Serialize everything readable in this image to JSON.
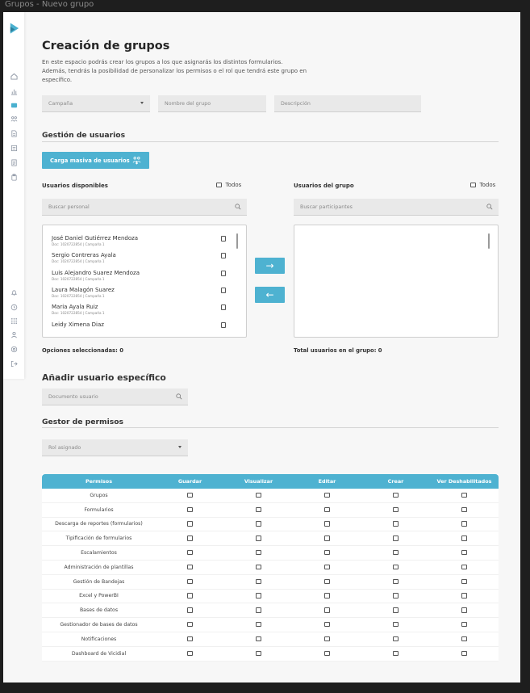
{
  "window": {
    "title": "Grupos - Nuevo grupo"
  },
  "colors": {
    "accent": "#4eb2d1",
    "background": "#f7f7f7"
  },
  "sidebar": {
    "logo": "logo-icon",
    "top_icons": [
      "home-icon",
      "chart-icon",
      "groups-icon",
      "users-icon",
      "forms-icon",
      "reports-icon",
      "document-icon",
      "clipboard-icon"
    ],
    "bottom_icons": [
      "bell-icon",
      "history-icon",
      "grid-icon",
      "profile-icon",
      "settings-icon",
      "logout-icon"
    ]
  },
  "page": {
    "title": "Creación de grupos",
    "intro": "En este espacio podrás crear los grupos a los que asignarás los distintos formularios. Además, tendrás la posibilidad de personalizar los permisos o el rol que tendrá este grupo en específico."
  },
  "form": {
    "campaign_placeholder": "Campaña",
    "group_name_placeholder": "Nombre del grupo",
    "description_placeholder": "Descripción"
  },
  "user_management": {
    "heading": "Gestión de usuarios",
    "mass_upload_label": "Carga masiva de usuarios",
    "available": {
      "title": "Usuarios disponibles",
      "all_label": "Todos",
      "search_placeholder": "Buscar personal",
      "users": [
        {
          "name": "José Daniel Gutiérrez Mendoza",
          "doc": "Doc: 1020722854 | Campaña 1"
        },
        {
          "name": "Sergio Contreras Ayala",
          "doc": "Doc: 1020722854 | Campaña 1"
        },
        {
          "name": "Luis Alejandro Suarez Mendoza",
          "doc": "Doc: 1020722854 | Campaña 1"
        },
        {
          "name": "Laura Malagón Suarez",
          "doc": "Doc: 1020722854 | Campaña 1"
        },
        {
          "name": "Maria Ayala Ruiz",
          "doc": "Doc: 1020722854 | Campaña 1"
        },
        {
          "name": "Leidy Ximena Diaz",
          "doc": ""
        }
      ],
      "selected_label": "Opciones seleccionadas: 0"
    },
    "group": {
      "title": "Usuarios del grupo",
      "all_label": "Todos",
      "search_placeholder": "Buscar participantes",
      "total_label": "Total usuarios en el grupo: 0"
    },
    "move_right": "→",
    "move_left": "←"
  },
  "specific_user": {
    "heading": "Añadir usuario específico",
    "document_placeholder": "Documento usuario"
  },
  "permissions": {
    "heading": "Gestor de permisos",
    "role_placeholder": "Rol asignado",
    "columns": [
      "Permisos",
      "Guardar",
      "Visualizar",
      "Editar",
      "Crear",
      "Ver Deshabilitados"
    ],
    "rows": [
      "Grupos",
      "Formularios",
      "Descarga de reportes (formularios)",
      "Tipificación de formularios",
      "Escalamientos",
      "Administración de plantillas",
      "Gestión de Bandejas",
      "Excel y PowerBI",
      "Bases de datos",
      "Gestionador de bases de datos",
      "Notificaciones",
      "Dashboard de Vicidial"
    ]
  }
}
